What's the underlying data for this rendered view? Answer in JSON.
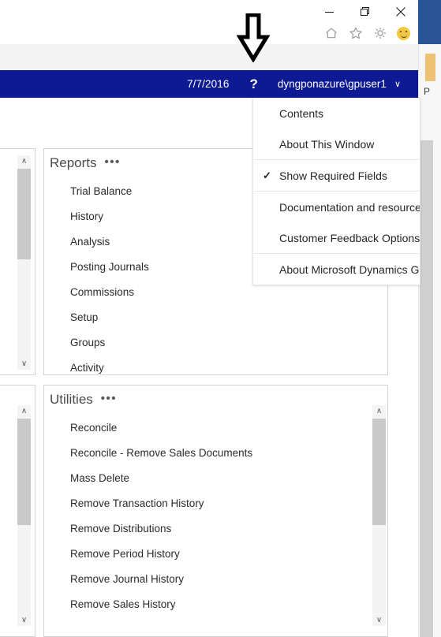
{
  "window": {
    "controls": [
      {
        "name": "minimize",
        "glyph": "minimize-icon"
      },
      {
        "name": "restore",
        "glyph": "restore-icon"
      },
      {
        "name": "close",
        "glyph": "close-icon"
      }
    ],
    "browser_icons": [
      {
        "name": "home-icon"
      },
      {
        "name": "favorites-star-icon"
      },
      {
        "name": "settings-gear-icon"
      },
      {
        "name": "feedback-smiley-icon"
      }
    ]
  },
  "appbar": {
    "date": "7/7/2016",
    "help_glyph": "?",
    "user": "dyngponazure\\gpuser1",
    "caret": "∨",
    "background": "#0d1a94"
  },
  "help_menu": {
    "items": [
      {
        "label": "Contents",
        "checked": false,
        "separator_after": false
      },
      {
        "label": "About This Window",
        "checked": false,
        "separator_after": true
      },
      {
        "label": "Show Required Fields",
        "checked": true,
        "separator_after": true
      },
      {
        "label": "Documentation and resources",
        "checked": false,
        "separator_after": false
      },
      {
        "label": "Customer Feedback Options.",
        "checked": false,
        "separator_after": true
      },
      {
        "label": "About Microsoft Dynamics GP",
        "checked": false,
        "separator_after": false
      }
    ],
    "check_glyph": "✓"
  },
  "cards": [
    {
      "id": "reports",
      "title": "Reports",
      "overflow": "•••",
      "items": [
        "Trial Balance",
        "History",
        "Analysis",
        "Posting Journals",
        "Commissions",
        "Setup",
        "Groups",
        "Activity"
      ]
    },
    {
      "id": "utilities",
      "title": "Utilities",
      "overflow": "•••",
      "items": [
        "Reconcile",
        "Reconcile - Remove Sales Documents",
        "Mass Delete",
        "Remove Transaction History",
        "Remove Distributions",
        "Remove Period History",
        "Remove Journal History",
        "Remove Sales History"
      ]
    }
  ],
  "scrollbars": {
    "up_glyph": "∧",
    "down_glyph": "∨"
  },
  "right_strip": {
    "tile_label": "P",
    "blue": "#2a5699",
    "tile_color": "#edc373"
  },
  "annotation": {
    "type": "down-arrow",
    "color": "#000000"
  }
}
